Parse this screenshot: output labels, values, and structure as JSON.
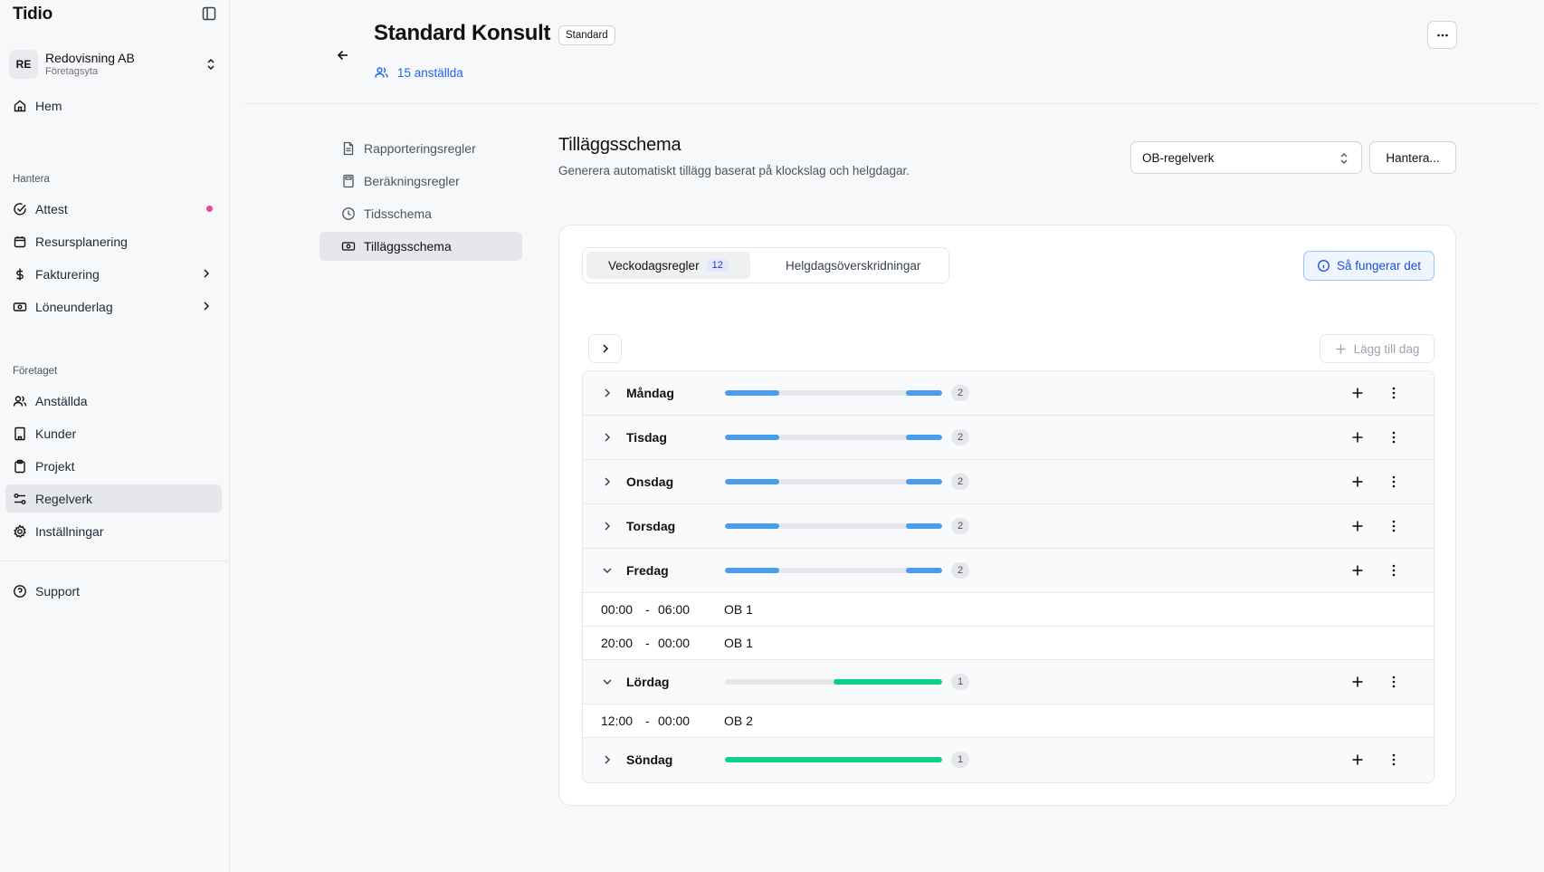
{
  "app": {
    "brand": "Tidio"
  },
  "company": {
    "initials": "RE",
    "name": "Redovisning AB",
    "subtitle": "Företagsyta"
  },
  "nav": {
    "home": "Hem",
    "section_manage": "Hantera",
    "attest": "Attest",
    "resource_planning": "Resursplanering",
    "billing": "Fakturering",
    "payroll": "Löneunderlag",
    "section_company": "Företaget",
    "employees": "Anställda",
    "customers": "Kunder",
    "projects": "Projekt",
    "rules": "Regelverk",
    "settings": "Inställningar",
    "support": "Support"
  },
  "header": {
    "title": "Standard Konsult",
    "badge": "Standard",
    "employees_link": "15 anställda"
  },
  "subnav": {
    "reporting": "Rapporteringsregler",
    "calculation": "Beräkningsregler",
    "time_schedule": "Tidsschema",
    "supplement": "Tilläggsschema"
  },
  "content": {
    "title": "Tilläggsschema",
    "subtitle": "Generera automatiskt tillägg baserat på klockslag och helgdagar.",
    "ruleset_value": "OB-regelverk",
    "manage_label": "Hantera..."
  },
  "card": {
    "tab_weekday": "Veckodagsregler",
    "tab_weekday_count": "12",
    "tab_holiday": "Helgdagsöverskridningar",
    "how_label": "Så fungerar det",
    "add_day_label": "Lägg till dag"
  },
  "colors": {
    "blue": "#4a9cf0",
    "green": "#10cf86",
    "accent": "#2563eb"
  },
  "days": [
    {
      "name": "Måndag",
      "count": "2"
    },
    {
      "name": "Tisdag",
      "count": "2"
    },
    {
      "name": "Onsdag",
      "count": "2"
    },
    {
      "name": "Torsdag",
      "count": "2"
    },
    {
      "name": "Fredag",
      "count": "2",
      "rules": [
        {
          "start": "00:00",
          "end": "06:00",
          "name": "OB 1"
        },
        {
          "start": "20:00",
          "end": "00:00",
          "name": "OB 1"
        }
      ]
    },
    {
      "name": "Lördag",
      "count": "1",
      "rules": [
        {
          "start": "12:00",
          "end": "00:00",
          "name": "OB 2"
        }
      ]
    },
    {
      "name": "Söndag",
      "count": "1"
    }
  ]
}
